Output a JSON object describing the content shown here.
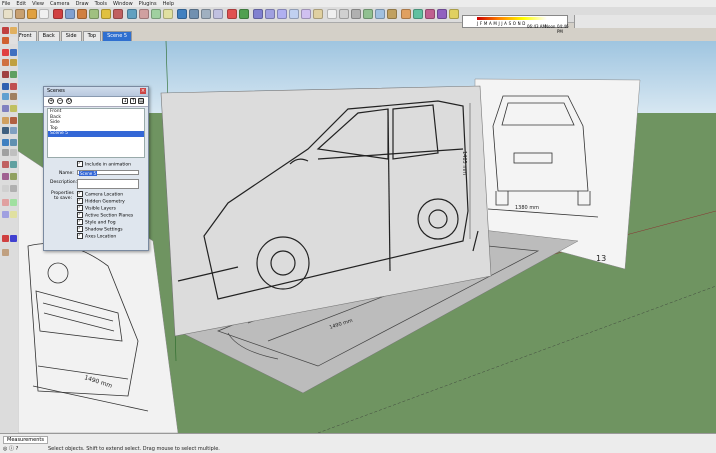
{
  "menu": [
    "File",
    "Edit",
    "View",
    "Camera",
    "Draw",
    "Tools",
    "Window",
    "Plugins",
    "Help"
  ],
  "scene_tabs": [
    {
      "label": "Front",
      "active": false
    },
    {
      "label": "Back",
      "active": false
    },
    {
      "label": "Side",
      "active": false
    },
    {
      "label": "Top",
      "active": false
    },
    {
      "label": "Scene 5",
      "active": true
    }
  ],
  "shadow_bar": {
    "months": "J F M A M J J A S O N D",
    "time_start": "06:43 AM",
    "noon": "Noon",
    "time_end": "04:46 PM"
  },
  "scenes_panel": {
    "title": "Scenes",
    "close": "×",
    "scene_list": [
      "Front",
      "Back",
      "Side",
      "Top",
      "Scene 5"
    ],
    "selected_index": 4,
    "include_in_animation": "Include in animation",
    "name_label": "Name:",
    "name_value": "Scene 5",
    "description_label": "Description:",
    "properties_label": "Properties",
    "to_save_label": "to save:",
    "properties": [
      "Camera Location",
      "Hidden Geometry",
      "Visible Layers",
      "Active Section Planes",
      "Style and Fog",
      "Shadow Settings",
      "Axes Location"
    ]
  },
  "drawings": {
    "side_dim": "1490 mm",
    "rear_dim": "1380 mm",
    "height_dim": "1465 mm",
    "front_dim": "1490 mm",
    "page_number": "13"
  },
  "statusbar": {
    "measurements_label": "Measurements",
    "status_text": "Select objects. Shift to extend select. Drag mouse to select multiple."
  },
  "colors": {
    "sky_top": "#9fc5e0",
    "sky_bottom": "#d7e7f2",
    "ground": "#6f9461",
    "selection": "#3367d6"
  }
}
